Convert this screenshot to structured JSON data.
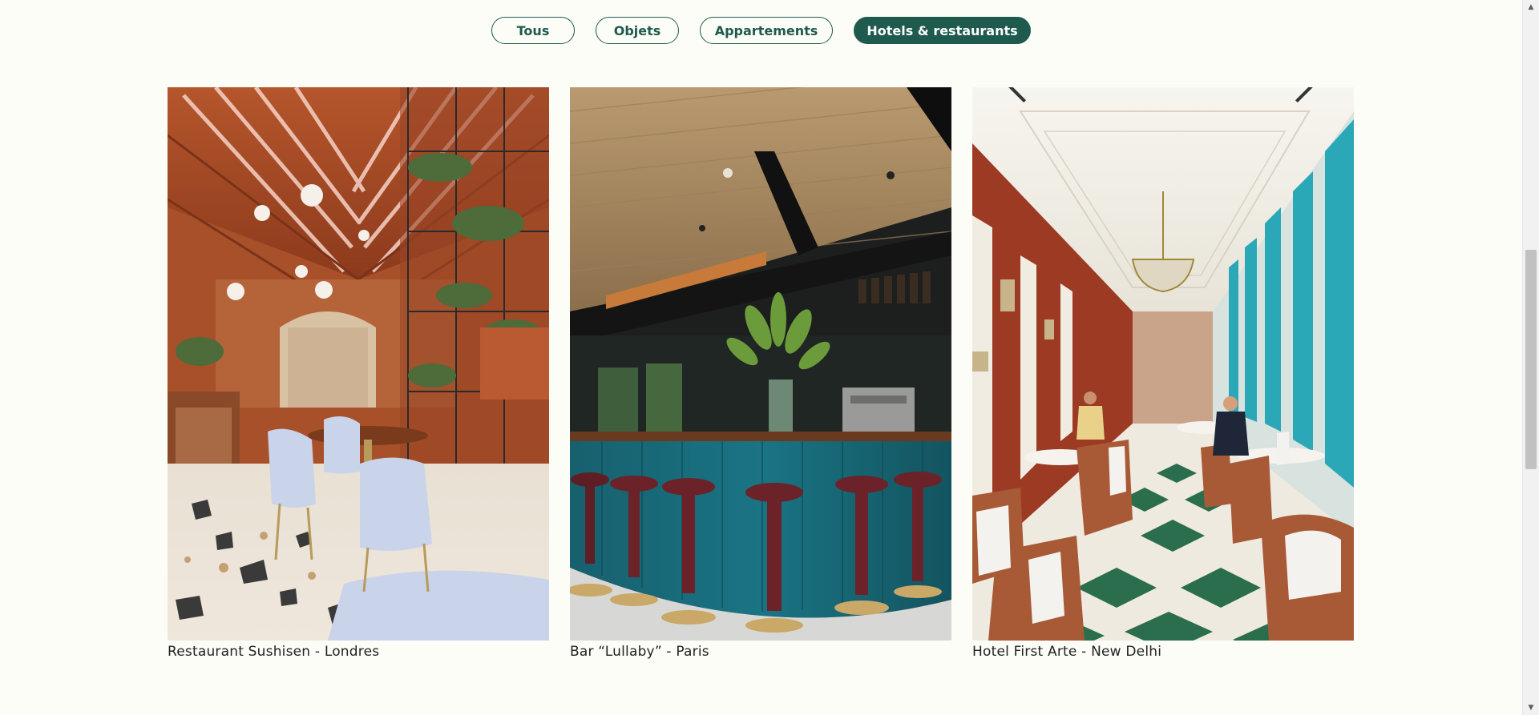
{
  "filters": [
    {
      "label": "Tous",
      "active": false
    },
    {
      "label": "Objets",
      "active": false
    },
    {
      "label": "Appartements",
      "active": false
    },
    {
      "label": "Hotels & restaurants",
      "active": true
    }
  ],
  "gallery": [
    {
      "caption": "Restaurant Sushisen - Londres",
      "image": "restaurant-interior-photo"
    },
    {
      "caption": "Bar “Lullaby” - Paris",
      "image": "bar-interior-photo"
    },
    {
      "caption": "Hotel First Arte - New Delhi",
      "image": "hotel-dining-hall-photo"
    }
  ],
  "colors": {
    "accent": "#1e5a4e",
    "background": "#fdfdf8",
    "caption_text": "#222222"
  },
  "scrollbar": {
    "up_icon": "scroll-up-arrow-icon",
    "down_icon": "scroll-down-arrow-icon"
  }
}
